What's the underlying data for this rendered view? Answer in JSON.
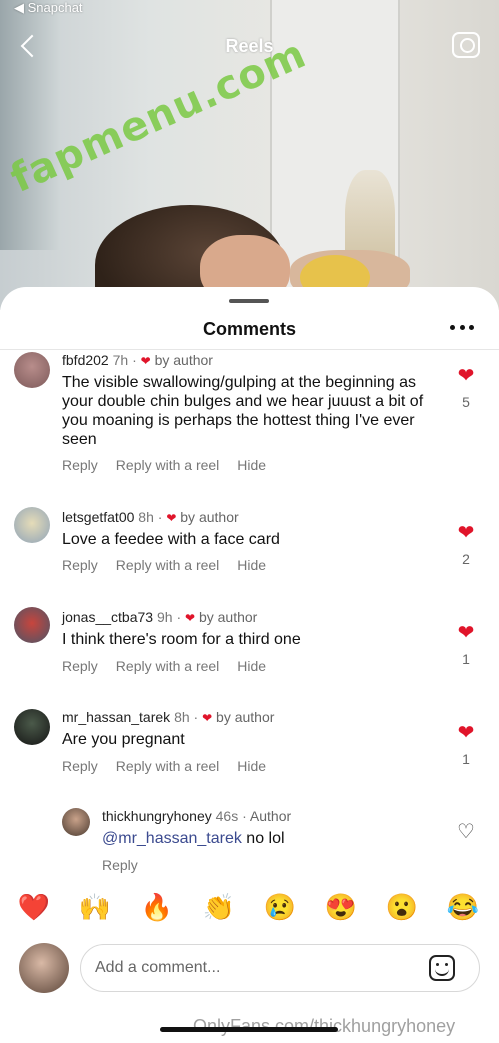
{
  "status_bar": {
    "back_app": "◀ Snapchat"
  },
  "header": {
    "title": "Reels"
  },
  "overlay": {
    "watermark": "fapmenu.com",
    "footer_watermark": "OnlyFans.com/thickhungryhoney"
  },
  "colors": {
    "like_red": "#e0142a",
    "mention_blue": "#3b4a8f",
    "watermark_green": "#7ac943"
  },
  "sheet": {
    "title": "Comments"
  },
  "comments": [
    {
      "username": "fbfd202",
      "time": "7h",
      "author_like": "by author",
      "text": "The visible swallowing/gulping at the beginning as your double chin bulges and we hear juuust a bit of you moaning is perhaps the hottest thing I've ever seen",
      "reply": "Reply",
      "reply_reel": "Reply with a reel",
      "hide": "Hide",
      "likes": "5"
    },
    {
      "username": "letsgetfat00",
      "time": "8h",
      "author_like": "by author",
      "text": "Love a feedee with a face card",
      "reply": "Reply",
      "reply_reel": "Reply with a reel",
      "hide": "Hide",
      "likes": "2"
    },
    {
      "username": "jonas__ctba73",
      "time": "9h",
      "author_like": "by author",
      "text": "I think there's room for a third one",
      "reply": "Reply",
      "reply_reel": "Reply with a reel",
      "hide": "Hide",
      "likes": "1"
    },
    {
      "username": "mr_hassan_tarek",
      "time": "8h",
      "author_like": "by author",
      "text": "Are you pregnant",
      "reply": "Reply",
      "reply_reel": "Reply with a reel",
      "hide": "Hide",
      "likes": "1"
    }
  ],
  "reply_comment": {
    "username": "thickhungryhoney",
    "time": "46s",
    "badge": "Author",
    "mention": "@mr_hassan_tarek",
    "text": " no lol",
    "reply": "Reply"
  },
  "emojis": [
    "❤️",
    "🙌",
    "🔥",
    "👏",
    "😢",
    "😍",
    "😮",
    "😂"
  ],
  "composer": {
    "placeholder": "Add a comment..."
  },
  "icons": {
    "back": "chevron-left-icon",
    "camera": "camera-icon",
    "more": "more-horizontal-icon",
    "heart": "heart-icon",
    "heart_outline": "heart-outline-icon",
    "sticker": "sticker-icon"
  }
}
